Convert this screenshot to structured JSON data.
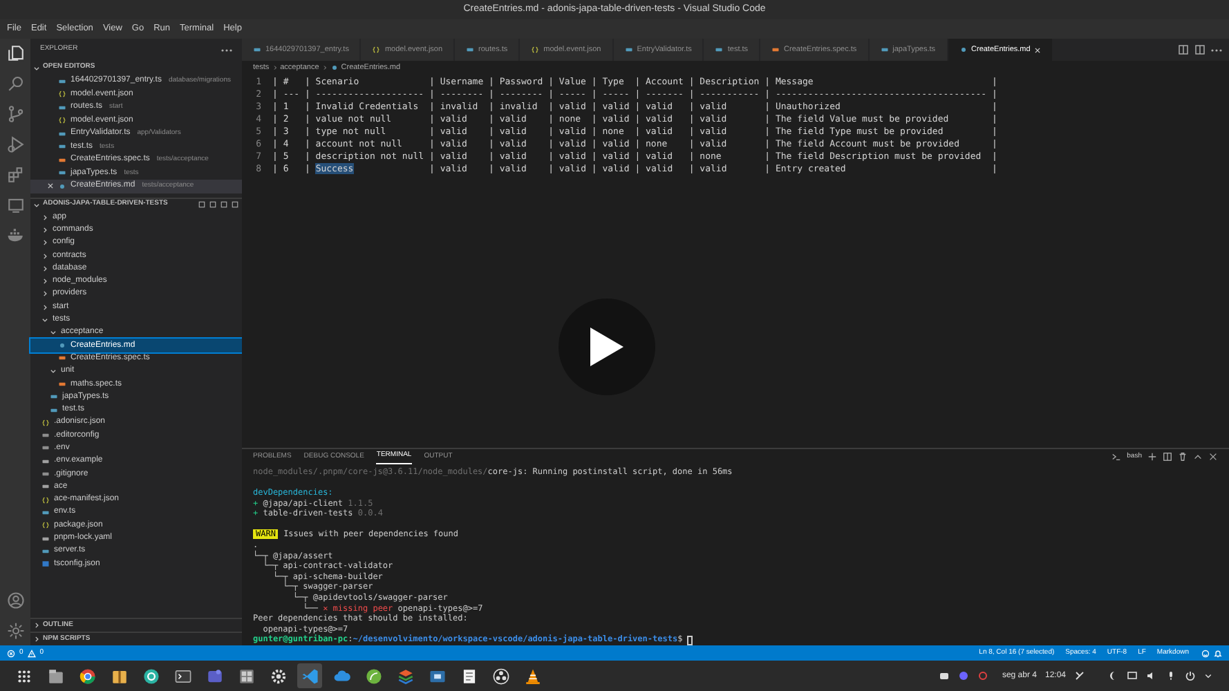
{
  "window": {
    "title": "CreateEntries.md - adonis-japa-table-driven-tests - Visual Studio Code"
  },
  "menu": [
    "File",
    "Edit",
    "Selection",
    "View",
    "Go",
    "Run",
    "Terminal",
    "Help"
  ],
  "sidebar": {
    "title": "EXPLORER",
    "open_editors": {
      "title": "OPEN EDITORS",
      "expanded": true,
      "items": [
        {
          "name": "1644029701397_entry.ts",
          "path": "database/migrations",
          "kind": "ts",
          "selected": false
        },
        {
          "name": "model.event.json",
          "kind": "json",
          "selected": false
        },
        {
          "name": "routes.ts",
          "path": "start",
          "kind": "ts",
          "selected": false
        },
        {
          "name": "model.event.json",
          "kind": "json",
          "selected": false
        },
        {
          "name": "EntryValidator.ts",
          "path": "app/Validators",
          "kind": "ts",
          "selected": false
        },
        {
          "name": "test.ts",
          "path": "tests",
          "kind": "ts",
          "selected": false
        },
        {
          "name": "CreateEntries.spec.ts",
          "path": "tests/acceptance",
          "kind": "spec",
          "selected": false
        },
        {
          "name": "japaTypes.ts",
          "path": "tests",
          "kind": "ts",
          "selected": false
        },
        {
          "name": "CreateEntries.md",
          "path": "tests/acceptance",
          "kind": "md",
          "selected": true
        }
      ]
    },
    "project": {
      "title": "ADONIS-JAPA-TABLE-DRIVEN-TESTS",
      "expanded": true,
      "items": [
        {
          "label": "app",
          "kind": "folder",
          "expanded": false,
          "selected": false
        },
        {
          "label": "commands",
          "kind": "folder",
          "expanded": false,
          "selected": false
        },
        {
          "label": "config",
          "kind": "folder",
          "expanded": false,
          "selected": false
        },
        {
          "label": "contracts",
          "kind": "folder",
          "expanded": false,
          "selected": false
        },
        {
          "label": "database",
          "kind": "folder",
          "expanded": false,
          "selected": false
        },
        {
          "label": "node_modules",
          "kind": "folder",
          "expanded": false,
          "selected": false
        },
        {
          "label": "providers",
          "kind": "folder",
          "expanded": false,
          "selected": false
        },
        {
          "label": "start",
          "kind": "folder",
          "expanded": false,
          "selected": false
        },
        {
          "label": "tests",
          "kind": "folder",
          "expanded": true,
          "selected": false,
          "children": [
            {
              "label": "acceptance",
              "kind": "folder",
              "expanded": true,
              "selected": false,
              "children": [
                {
                  "label": "CreateEntries.md",
                  "kind": "md",
                  "selected": true
                },
                {
                  "label": "CreateEntries.spec.ts",
                  "kind": "spec",
                  "selected": false
                }
              ]
            },
            {
              "label": "unit",
              "kind": "folder",
              "expanded": true,
              "selected": false,
              "children": [
                {
                  "label": "maths.spec.ts",
                  "kind": "spec",
                  "selected": false
                }
              ]
            },
            {
              "label": "japaTypes.ts",
              "kind": "ts",
              "selected": false
            },
            {
              "label": "test.ts",
              "kind": "ts",
              "selected": false
            }
          ]
        },
        {
          "label": ".adonisrc.json",
          "kind": "json",
          "selected": false
        },
        {
          "label": ".editorconfig",
          "kind": "config",
          "selected": false
        },
        {
          "label": ".env",
          "kind": "config",
          "selected": false
        },
        {
          "label": ".env.example",
          "kind": "text",
          "selected": false
        },
        {
          "label": ".gitignore",
          "kind": "config",
          "selected": false
        },
        {
          "label": "ace",
          "kind": "text",
          "selected": false
        },
        {
          "label": "ace-manifest.json",
          "kind": "json",
          "selected": false
        },
        {
          "label": "env.ts",
          "kind": "ts",
          "selected": false
        },
        {
          "label": "package.json",
          "kind": "json",
          "selected": false
        },
        {
          "label": "pnpm-lock.yaml",
          "kind": "text",
          "selected": false
        },
        {
          "label": "server.ts",
          "kind": "ts",
          "selected": false
        },
        {
          "label": "tsconfig.json",
          "kind": "tsconfig",
          "selected": false
        }
      ]
    },
    "sections": [
      {
        "title": "OUTLINE",
        "expanded": false
      },
      {
        "title": "NPM SCRIPTS",
        "expanded": false
      }
    ]
  },
  "tabs": [
    {
      "label": "1644029701397_entry.ts",
      "kind": "ts",
      "selected": false
    },
    {
      "label": "model.event.json",
      "kind": "json",
      "selected": false
    },
    {
      "label": "routes.ts",
      "kind": "ts",
      "selected": false
    },
    {
      "label": "model.event.json",
      "kind": "json",
      "selected": false
    },
    {
      "label": "EntryValidator.ts",
      "kind": "ts",
      "selected": false
    },
    {
      "label": "test.ts",
      "kind": "ts",
      "selected": false
    },
    {
      "label": "CreateEntries.spec.ts",
      "kind": "spec",
      "selected": false
    },
    {
      "label": "japaTypes.ts",
      "kind": "ts",
      "selected": false
    },
    {
      "label": "CreateEntries.md",
      "kind": "md",
      "selected": true
    }
  ],
  "breadcrumb": [
    "tests",
    "acceptance",
    "CreateEntries.md"
  ],
  "editor": {
    "lines": [
      {
        "number": "1",
        "parts": [
          {
            "text": "| #   | Scenario             | Username | Password | Value | Type  | Account | Description | Message                                 |",
            "selected": false
          }
        ]
      },
      {
        "number": "2",
        "parts": [
          {
            "text": "| --- | -------------------- | -------- | -------- | ----- | ----- | ------- | ----------- | --------------------------------------- |",
            "selected": false
          }
        ]
      },
      {
        "number": "3",
        "parts": [
          {
            "text": "| 1   | Invalid Credentials  | invalid  | invalid  | valid | valid | valid   | valid       | Unauthorized                            |",
            "selected": false
          }
        ]
      },
      {
        "number": "4",
        "parts": [
          {
            "text": "| 2   | value not null       | valid    | valid    | none  | valid | valid   | valid       | The field Value must be provided        |",
            "selected": false
          }
        ]
      },
      {
        "number": "5",
        "parts": [
          {
            "text": "| 3   | type not null        | valid    | valid    | valid | none  | valid   | valid       | The field Type must be provided         |",
            "selected": false
          }
        ]
      },
      {
        "number": "6",
        "parts": [
          {
            "text": "| 4   | account not null     | valid    | valid    | valid | valid | none    | valid       | The field Account must be provided      |",
            "selected": false
          }
        ]
      },
      {
        "number": "7",
        "parts": [
          {
            "text": "| 5   | description not null | valid    | valid    | valid | valid | valid   | none        | The field Description must be provided  |",
            "selected": false
          }
        ]
      },
      {
        "number": "8",
        "parts": [
          {
            "text": "| 6   | ",
            "selected": false
          },
          {
            "text": "Success",
            "selected": true
          },
          {
            "text": "              | valid    | valid    | valid | valid | valid   | valid       | Entry created                           |",
            "selected": false
          }
        ]
      }
    ]
  },
  "panel": {
    "tabs": [
      {
        "label": "PROBLEMS",
        "selected": false
      },
      {
        "label": "DEBUG CONSOLE",
        "selected": false
      },
      {
        "label": "TERMINAL",
        "selected": true
      },
      {
        "label": "OUTPUT",
        "selected": false
      }
    ],
    "shell": "bash",
    "terminal": [
      {
        "kind": "text",
        "segments": [
          {
            "kind": "dim",
            "text": "node_modules/.pnpm/core-js@3.6.11/node_modules/"
          },
          {
            "kind": "normal",
            "text": "core-js: Running postinstall script, done in 56ms"
          }
        ]
      },
      {
        "kind": "blank"
      },
      {
        "kind": "text",
        "segments": [
          {
            "kind": "cyan",
            "text": "devDependencies:"
          }
        ]
      },
      {
        "kind": "text",
        "segments": [
          {
            "kind": "green",
            "text": "+ "
          },
          {
            "kind": "normal",
            "text": "@japa/api-client "
          },
          {
            "kind": "dim",
            "text": "1.1.5"
          }
        ]
      },
      {
        "kind": "text",
        "segments": [
          {
            "kind": "green",
            "text": "+ "
          },
          {
            "kind": "normal",
            "text": "table-driven-tests "
          },
          {
            "kind": "dim",
            "text": "0.0.4"
          }
        ]
      },
      {
        "kind": "blank"
      },
      {
        "kind": "text",
        "segments": [
          {
            "kind": "badge",
            "text": "WARN"
          },
          {
            "kind": "normal",
            "text": " Issues with peer dependencies found"
          }
        ]
      },
      {
        "kind": "text",
        "segments": [
          {
            "kind": "normal",
            "text": "."
          }
        ]
      },
      {
        "kind": "text",
        "segments": [
          {
            "kind": "normal",
            "text": "└─┬ @japa/assert"
          }
        ]
      },
      {
        "kind": "text",
        "segments": [
          {
            "kind": "normal",
            "text": "  └─┬ api-contract-validator"
          }
        ]
      },
      {
        "kind": "text",
        "segments": [
          {
            "kind": "normal",
            "text": "    └─┬ api-schema-builder"
          }
        ]
      },
      {
        "kind": "text",
        "segments": [
          {
            "kind": "normal",
            "text": "      └─┬ swagger-parser"
          }
        ]
      },
      {
        "kind": "text",
        "segments": [
          {
            "kind": "normal",
            "text": "        └─┬ @apidevtools/swagger-parser"
          }
        ]
      },
      {
        "kind": "text",
        "segments": [
          {
            "kind": "normal",
            "text": "          └── "
          },
          {
            "kind": "red",
            "text": "✕ missing peer"
          },
          {
            "kind": "normal",
            "text": " openapi-types@>=7"
          }
        ]
      },
      {
        "kind": "text",
        "segments": [
          {
            "kind": "normal",
            "text": "Peer dependencies that should be installed:"
          }
        ]
      },
      {
        "kind": "text",
        "segments": [
          {
            "kind": "normal",
            "text": "  openapi-types@>=7"
          }
        ]
      },
      {
        "kind": "prompt",
        "segments": [
          {
            "kind": "user",
            "text": "gunter@guntriban-pc"
          },
          {
            "kind": "normal",
            "text": ":"
          },
          {
            "kind": "path",
            "text": "~/desenvolvimento/workspace-vscode/adonis-japa-table-driven-tests"
          },
          {
            "kind": "normal",
            "text": "$ "
          }
        ]
      }
    ]
  },
  "status_bar": {
    "errors": "0",
    "warnings": "0",
    "items": [
      "Ln 8, Col 16 (7 selected)",
      "Spaces: 4",
      "UTF-8",
      "LF",
      "Markdown"
    ]
  },
  "taskbar": {
    "apps": [
      {
        "kind": "launcher",
        "active": false
      },
      {
        "kind": "files",
        "active": false
      },
      {
        "kind": "browser",
        "active": false
      },
      {
        "kind": "archive",
        "active": false
      },
      {
        "kind": "circle",
        "active": false
      },
      {
        "kind": "terminal",
        "active": false
      },
      {
        "kind": "chat",
        "active": false
      },
      {
        "kind": "calculator",
        "active": false
      },
      {
        "kind": "gear",
        "active": false
      },
      {
        "kind": "code",
        "active": true
      },
      {
        "kind": "cloud",
        "active": false
      },
      {
        "kind": "leaf",
        "active": false
      },
      {
        "kind": "layers",
        "active": false
      },
      {
        "kind": "window",
        "active": false
      },
      {
        "kind": "notepad",
        "active": false
      },
      {
        "kind": "record",
        "active": false
      },
      {
        "kind": "cone",
        "active": false
      }
    ],
    "date": "seg abr 4",
    "time": "12:04"
  }
}
